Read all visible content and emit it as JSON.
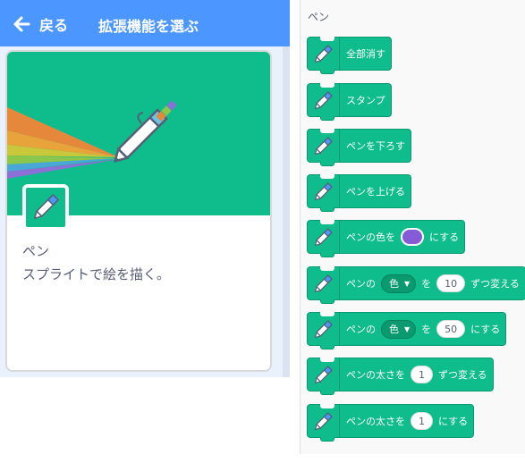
{
  "header": {
    "back_label": "戻る",
    "title": "拡張機能を選ぶ"
  },
  "extension_card": {
    "name": "ペン",
    "description": "スプライトで絵を描く。",
    "hero_color": "#0fbd8c",
    "icon": "pen-icon"
  },
  "palette": {
    "category_title": "ペン",
    "block_color": "#0fbd8c",
    "pen_color_swatch": "#855cd6",
    "blocks": [
      {
        "parts": [
          "全部消す"
        ]
      },
      {
        "parts": [
          "スタンプ"
        ]
      },
      {
        "parts": [
          "ペンを下ろす"
        ]
      },
      {
        "parts": [
          "ペンを上げる"
        ]
      },
      {
        "parts": [
          "ペンの色を",
          "にする"
        ]
      },
      {
        "parts": [
          "ペンの",
          "色",
          "を",
          "10",
          "ずつ変える"
        ]
      },
      {
        "parts": [
          "ペンの",
          "色",
          "を",
          "50",
          "にする"
        ]
      },
      {
        "parts": [
          "ペンの太さを",
          "1",
          "ずつ変える"
        ]
      },
      {
        "parts": [
          "ペンの太さを",
          "1",
          "にする"
        ]
      }
    ]
  }
}
